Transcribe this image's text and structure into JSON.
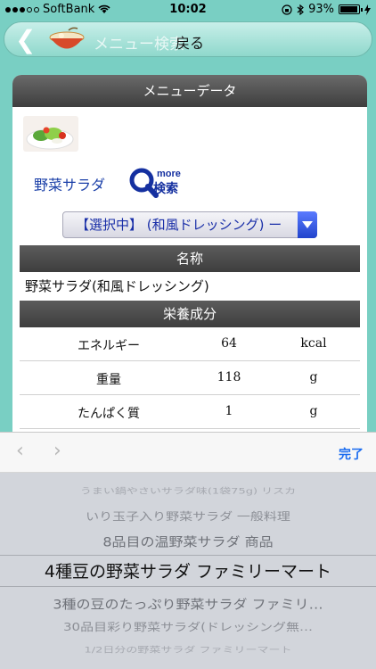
{
  "status": {
    "carrier": "SoftBank",
    "time": "10:02",
    "battery": "93%",
    "battery_level": 0.93
  },
  "header": {
    "title": "メニュー検索",
    "back_label": "戻る"
  },
  "card": {
    "title": "メニューデータ",
    "food_name": "野菜サラダ",
    "more_label": "more",
    "search_label": "検索",
    "select_value": "【選択中】 (和風ドレッシング) ー",
    "name_section": "名称",
    "name_value": "野菜サラダ(和風ドレッシング)",
    "nutrition_section": "栄養成分",
    "nutrition": [
      {
        "label": "エネルギー",
        "value": "64",
        "unit": "kcal"
      },
      {
        "label": "重量",
        "value": "118",
        "unit": "g"
      },
      {
        "label": "たんぱく質",
        "value": "1",
        "unit": "g"
      }
    ]
  },
  "picker": {
    "prev_label": "‹",
    "next_label": "›",
    "done_label": "完了",
    "items": [
      "うまい鍋やさいサラダ味(1袋75g) リスカ",
      "いり玉子入り野菜サラダ 一般料理",
      "8品目の温野菜サラダ 商品",
      "4種豆の野菜サラダ ファミリーマート",
      "3種の豆のたっぷり野菜サラダ ファミリ…",
      "30品目彩り野菜サラダ(ドレッシング無…",
      "1/2日分の野菜サラダ ファミリーマート"
    ],
    "selected_index": 3
  }
}
